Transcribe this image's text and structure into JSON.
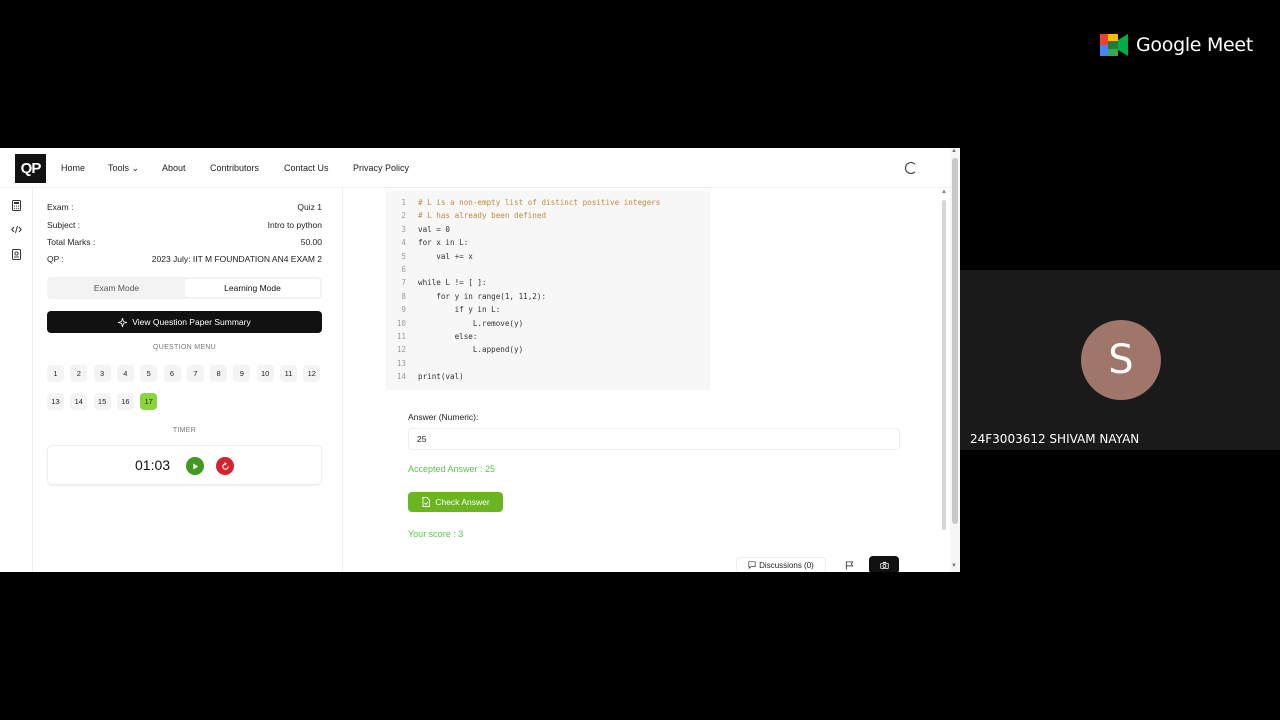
{
  "meet": {
    "brand": "Google Meet",
    "participant_initial": "S",
    "participant_name": "24F3003612 SHIVAM NAYAN"
  },
  "site": {
    "logo": "QP",
    "nav": [
      {
        "label": "Home"
      },
      {
        "label": "Tools ⌄"
      },
      {
        "label": "About"
      },
      {
        "label": "Contributors"
      },
      {
        "label": "Contact Us"
      },
      {
        "label": "Privacy Policy"
      }
    ]
  },
  "rail_icons": [
    "calculator-icon",
    "code-icon",
    "book-icon"
  ],
  "exam_info": [
    {
      "label": "Exam :",
      "value": "Quiz 1"
    },
    {
      "label": "Subject :",
      "value": "Intro to python"
    },
    {
      "label": "Total Marks :",
      "value": "50.00"
    },
    {
      "label": "QP :",
      "value": "2023 July: IIT M FOUNDATION AN4 EXAM 2"
    }
  ],
  "modes": {
    "exam": "Exam Mode",
    "learning": "Learning Mode",
    "active": "learning"
  },
  "summary_button": "View Question Paper Summary",
  "question_menu": {
    "label": "QUESTION MENU",
    "questions": [
      "1",
      "2",
      "3",
      "4",
      "5",
      "6",
      "7",
      "8",
      "9",
      "10",
      "11",
      "12",
      "13",
      "14",
      "15",
      "16",
      "17"
    ],
    "current": "17"
  },
  "timer": {
    "label": "TIMER",
    "value": "01:03"
  },
  "code": [
    {
      "n": "1",
      "text": "# L is a non-empty list of distinct positive integers",
      "comment": true
    },
    {
      "n": "2",
      "text": "# L has already been defined",
      "comment": true
    },
    {
      "n": "3",
      "text": "val = 0",
      "comment": false
    },
    {
      "n": "4",
      "text": "for x in L:",
      "comment": false
    },
    {
      "n": "5",
      "text": "    val += x",
      "comment": false
    },
    {
      "n": "6",
      "text": "",
      "comment": false
    },
    {
      "n": "7",
      "text": "while L != [ ]:",
      "comment": false
    },
    {
      "n": "8",
      "text": "    for y in range(1, 11,2):",
      "comment": false
    },
    {
      "n": "9",
      "text": "        if y in L:",
      "comment": false
    },
    {
      "n": "10",
      "text": "            L.remove(y)",
      "comment": false
    },
    {
      "n": "11",
      "text": "        else:",
      "comment": false
    },
    {
      "n": "12",
      "text": "            L.append(y)",
      "comment": false
    },
    {
      "n": "13",
      "text": "",
      "comment": false
    },
    {
      "n": "14",
      "text": "print(val)",
      "comment": false
    }
  ],
  "answer": {
    "label": "Answer (Numeric):",
    "value": "25",
    "accepted": "Accepted Answer : 25",
    "check_button": "Check Answer",
    "score": "Your score : 3"
  },
  "footer": {
    "discussions": "Discussions (0)"
  },
  "colors": {
    "accent_green": "#6ab520",
    "current_question": "#8bd43a",
    "timer_play": "#3f9a1f",
    "timer_reset": "#d2242f"
  }
}
